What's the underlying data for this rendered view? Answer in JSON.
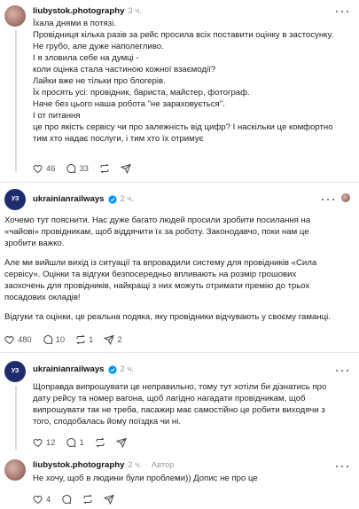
{
  "post1": {
    "username": "liubystok.photography",
    "time": "3 ч.",
    "lines": [
      "Їхала днями в потязі.",
      "Провідниця кілька разів за рейс просила всіх поставити оцінку в застосунку.",
      "Не грубо, але дуже наполегливо.",
      "І я зловила себе на думці -",
      "коли оцінка стала частиною кожної взаємодії?",
      "Лайки вже не тільки про блогерів.",
      "Їх просять усі: провідник, бариста, майстер, фотограф.",
      "Наче без цього наша робота \"не зараховується\".",
      "І от питання",
      "це про якість сервісу чи про залежність від цифр? І наскільки це комфортно",
      "тим хто надає послуги, і тим хто їх отримує"
    ],
    "likes": "46",
    "comments": "33",
    "reposts": "",
    "shares": ""
  },
  "post2": {
    "username": "ukrainianrailways",
    "avatar_text": "УЗ",
    "time": "2 ч.",
    "paragraphs": [
      [
        "Хочемо тут пояснити. Нас дуже багато людей просили зробити посилання на",
        "«чайові» провідникам, щоб віддячити їх за роботу. Законодавчо, поки нам це",
        "зробити важко."
      ],
      [
        "Але ми вийшли вихід із ситуації та впровадили систему для провідників «Сила",
        "сервісу». Оцінки та відгуки безпосередньо впливають на розмір грошових",
        "заохочень для провідників, найкращі з них можуть отримати премію до трьох",
        "посадових окладів!"
      ],
      [
        "Відгуки та оцінки, це реальна подяка, яку провідники відчувають у своєму гаманці."
      ]
    ],
    "likes": "480",
    "comments": "10",
    "reposts": "1",
    "shares": "2"
  },
  "post3": {
    "username": "ukrainianrailways",
    "avatar_text": "УЗ",
    "time": "2 ч.",
    "lines": [
      "Щоправда випрошувати це неправильно, тому тут хотіли би дізнатись про",
      "дату рейсу та номер вагона, щоб лагідно нагадати провідникам, щоб",
      "випрошувати так не треба, пасажир має самостійно це робити виходячи з",
      "того, сподобалась йому поїздка чи ні."
    ],
    "likes": "12",
    "comments": "1",
    "reposts": "",
    "shares": ""
  },
  "post4": {
    "username": "liubystok.photography",
    "time": "2 ч.",
    "author_label": "Автор",
    "lines": [
      "Не хочу, щоб в людини були проблеми)) Допис не про це"
    ],
    "likes": "4",
    "comments": "",
    "reposts": "",
    "shares": ""
  },
  "colors": {
    "verified": "#0095f6",
    "brand": "#1e2c6e",
    "muted": "#999999"
  }
}
